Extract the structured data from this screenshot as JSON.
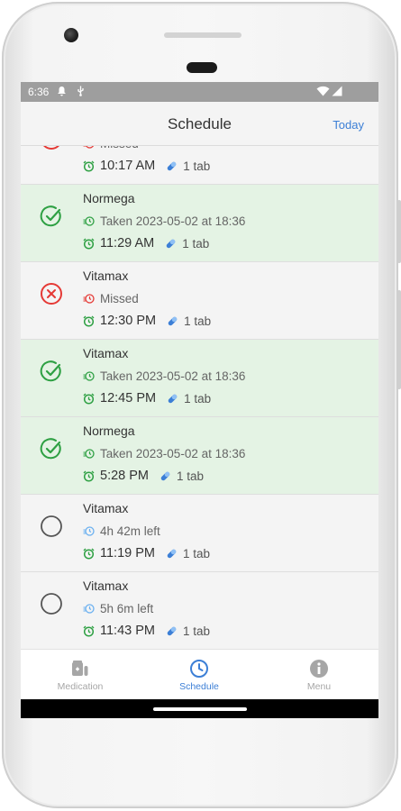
{
  "status_bar": {
    "time": "6:36",
    "notification_icons": [
      "bell-icon",
      "usb-icon"
    ],
    "system_icons": [
      "wifi-icon",
      "signal-icon"
    ]
  },
  "app_bar": {
    "title": "Schedule",
    "today_label": "Today"
  },
  "schedule": {
    "items": [
      {
        "status": "missed",
        "name": "",
        "state_text": "Missed",
        "time": "10:17 AM",
        "dose": "1 tab"
      },
      {
        "status": "taken",
        "name": "Normega",
        "state_text": "Taken 2023-05-02 at 18:36",
        "time": "11:29 AM",
        "dose": "1 tab"
      },
      {
        "status": "missed",
        "name": "Vitamax",
        "state_text": "Missed",
        "time": "12:30 PM",
        "dose": "1 tab"
      },
      {
        "status": "taken",
        "name": "Vitamax",
        "state_text": "Taken 2023-05-02 at 18:36",
        "time": "12:45 PM",
        "dose": "1 tab"
      },
      {
        "status": "taken",
        "name": "Normega",
        "state_text": "Taken 2023-05-02 at 18:36",
        "time": "5:28 PM",
        "dose": "1 tab"
      },
      {
        "status": "pending",
        "name": "Vitamax",
        "state_text": "4h 42m left",
        "time": "11:19 PM",
        "dose": "1 tab"
      },
      {
        "status": "pending",
        "name": "Vitamax",
        "state_text": "5h 6m left",
        "time": "11:43 PM",
        "dose": "1 tab"
      }
    ]
  },
  "bottom_nav": {
    "items": [
      {
        "label": "Medication",
        "icon": "medication-icon",
        "active": false
      },
      {
        "label": "Schedule",
        "icon": "clock-icon",
        "active": true
      },
      {
        "label": "Menu",
        "icon": "info-icon",
        "active": false
      }
    ]
  },
  "colors": {
    "accent": "#3c7fd6",
    "taken_green": "#2ea043",
    "missed_red": "#e53935",
    "taken_row_bg": "#e4f3e4",
    "pending_blue": "#6ab0f0"
  }
}
